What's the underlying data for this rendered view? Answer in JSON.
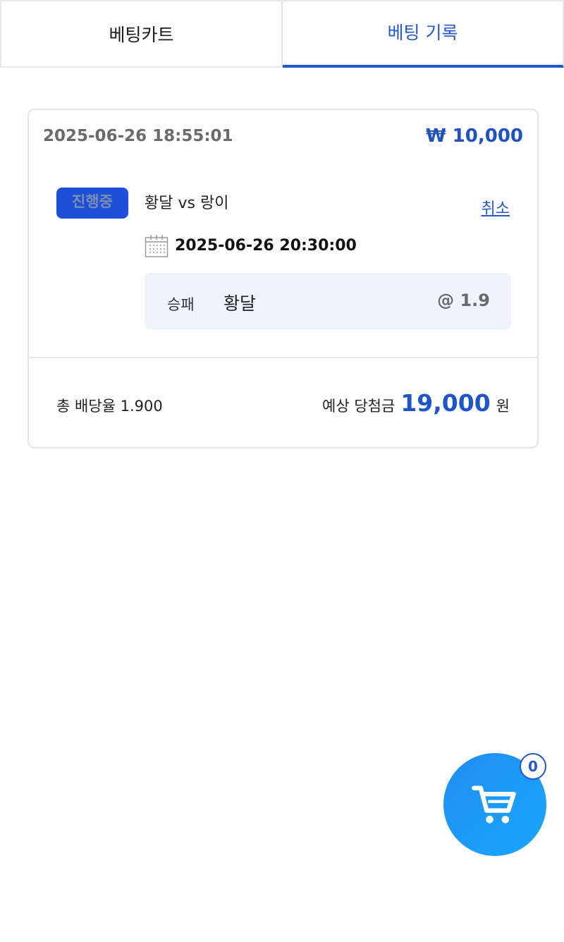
{
  "tabs": {
    "cart_label": "베팅카트",
    "history_label": "베팅 기록"
  },
  "bet": {
    "placed_at": "2025-06-26 18:55:01",
    "stake": "₩ 10,000",
    "status": "진행중",
    "match": "황달 vs 랑이",
    "cancel_label": "취소",
    "match_time": "2025-06-26 20:30:00",
    "market": "승패",
    "selection": "황달",
    "odds": "@ 1.9",
    "total_odds": "총 배당율 1.900",
    "expected_label": "예상 당첨금",
    "expected_amount": "19,000",
    "currency": "원"
  },
  "cart": {
    "count": "0",
    "icon": "cart-icon"
  },
  "colors": {
    "accent": "#1f56c8",
    "fab": "#1a9bff",
    "pick_bg": "#eff3fb"
  }
}
